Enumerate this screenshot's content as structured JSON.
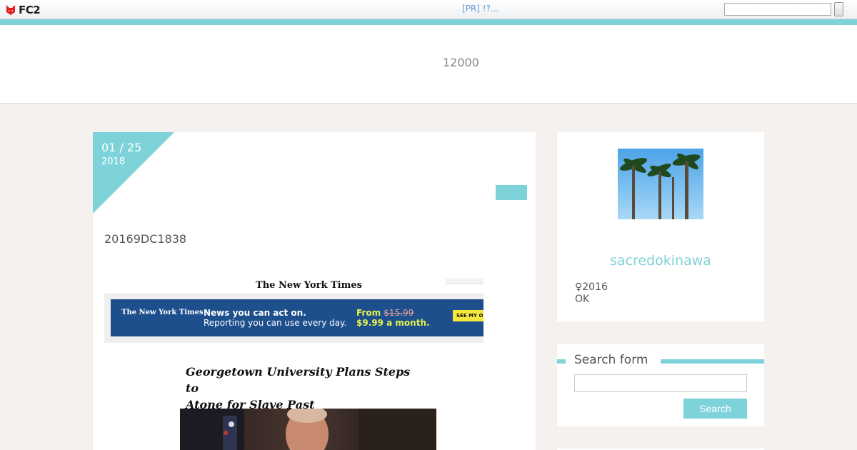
{
  "fc2_bar": {
    "logo_text": "FC2",
    "pr_link": "[PR] !?...",
    "search_placeholder": ""
  },
  "header": {
    "count_text": "12000"
  },
  "article": {
    "date_month_day": "01 / 25",
    "date_year": "2018",
    "title": "20169DC1838",
    "screenshot": {
      "masthead": "The New York Times",
      "ad": {
        "logo": "The New York Times",
        "headline": "News you can act on.",
        "subline": "Reporting you can use every day.",
        "from_label": "From",
        "old_price": "$15.99",
        "new_price": "$9.99 a month.",
        "button": "SEE MY OPTIONS"
      },
      "headline_line1": "Georgetown University Plans Steps to",
      "headline_line2": "Atone for Slave Past"
    }
  },
  "sidebar": {
    "profile": {
      "name": "sacredokinawa",
      "line1": "♀2016",
      "line2": "OK"
    },
    "search": {
      "title": "Search form",
      "button": "Search"
    }
  },
  "colors": {
    "accent": "#7dd3d9",
    "background": "#f5f1ee"
  }
}
